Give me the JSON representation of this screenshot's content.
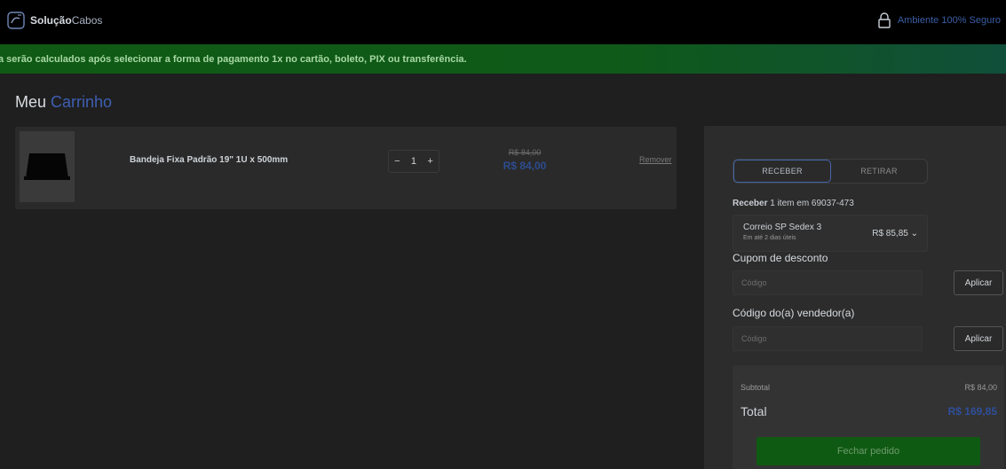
{
  "header": {
    "logo_bold": "Solução",
    "logo_light": "Cabos",
    "secure_label": "Ambiente 100% Seguro"
  },
  "notice": {
    "text": "a serão calculados após selecionar a forma de pagamento 1x no cartão, boleto, PIX ou transferência."
  },
  "page": {
    "title_prefix": "Meu",
    "title_accent": "Carrinho"
  },
  "cart": {
    "items": [
      {
        "name": "Bandeja Fixa Padrão 19\" 1U x 500mm",
        "quantity": "1",
        "minus": "−",
        "plus": "+",
        "price_old": "R$ 84,00",
        "price_new": "R$ 84,00",
        "remove_label": "Remover"
      }
    ]
  },
  "delivery": {
    "tabs": [
      "RECEBER",
      "RETIRAR"
    ],
    "active_tab": "RECEBER",
    "receive_bold": "Receber",
    "receive_rest": " 1 item em 69037-473",
    "shipping_name": "Correio SP Sedex 3",
    "shipping_sub": "Em até 2 dias úteis",
    "shipping_price": "R$ 85,85",
    "shipping_chevron": "⌄"
  },
  "coupon": {
    "label": "Cupom de desconto",
    "placeholder": "Código",
    "button": "Aplicar"
  },
  "seller": {
    "label": "Código do(a) vendedor(a)",
    "placeholder": "Código",
    "button": "Aplicar"
  },
  "summary": {
    "subtotal_label": "Subtotal",
    "subtotal_value": "R$ 84,00",
    "total_label": "Total",
    "total_value": "R$ 169,85",
    "checkout_label": "Fechar pedido"
  },
  "colors": {
    "accent_blue": "#3e5fb3",
    "notice_green": "#0f5a14",
    "checkout_green": "#0f5a12"
  },
  "icons": {
    "logo": "logo-mark-icon",
    "lock": "lock-icon",
    "chevron": "chevron-down-icon"
  }
}
